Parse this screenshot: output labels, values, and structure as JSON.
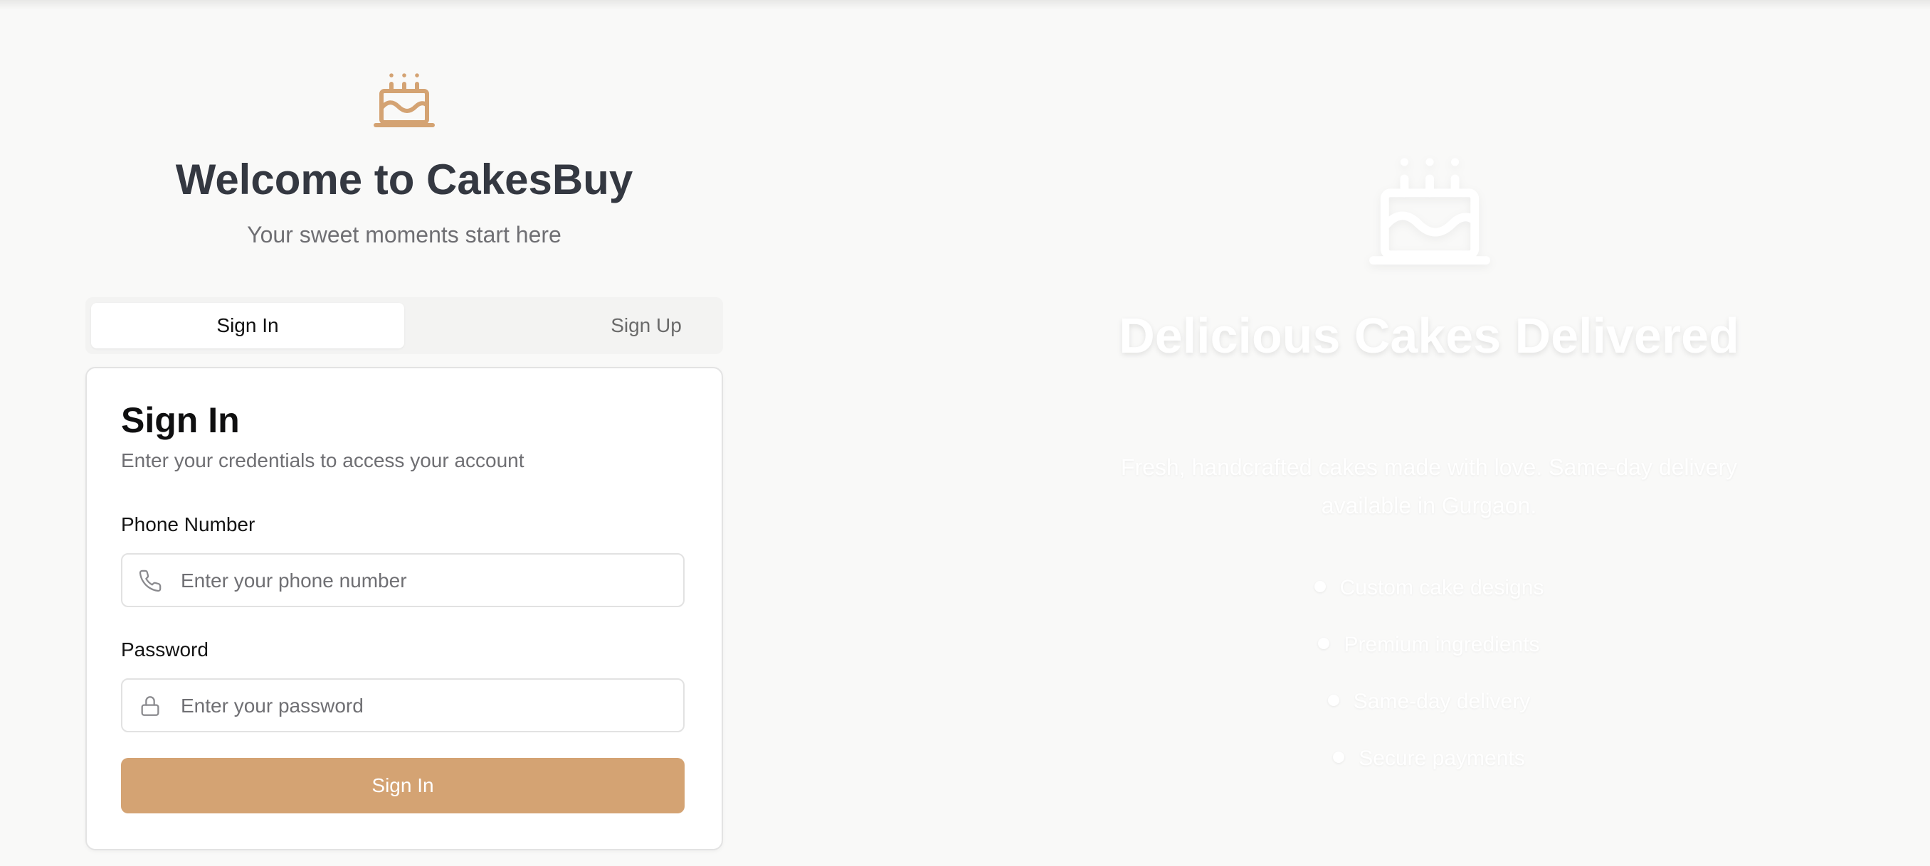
{
  "brand": {
    "icon": "cake-icon",
    "accent_color": "#d4a373",
    "welcome_title": "Welcome to CakesBuy",
    "welcome_subtitle": "Your sweet moments start here"
  },
  "tabs": [
    {
      "label": "Sign In",
      "active": true
    },
    {
      "label": "Sign Up",
      "active": false
    }
  ],
  "signin": {
    "title": "Sign In",
    "description": "Enter your credentials to access your account",
    "phone": {
      "label": "Phone Number",
      "placeholder": "Enter your phone number",
      "value": "",
      "icon": "phone-icon"
    },
    "password": {
      "label": "Password",
      "placeholder": "Enter your password",
      "value": "",
      "icon": "lock-icon"
    },
    "submit_label": "Sign In"
  },
  "hero": {
    "icon": "cake-icon",
    "title": "Delicious Cakes Delivered",
    "description": "Fresh, handcrafted cakes made with love. Same-day delivery available in Gurgaon.",
    "features": [
      "Custom cake designs",
      "Premium ingredients",
      "Same-day delivery",
      "Secure payments"
    ]
  }
}
